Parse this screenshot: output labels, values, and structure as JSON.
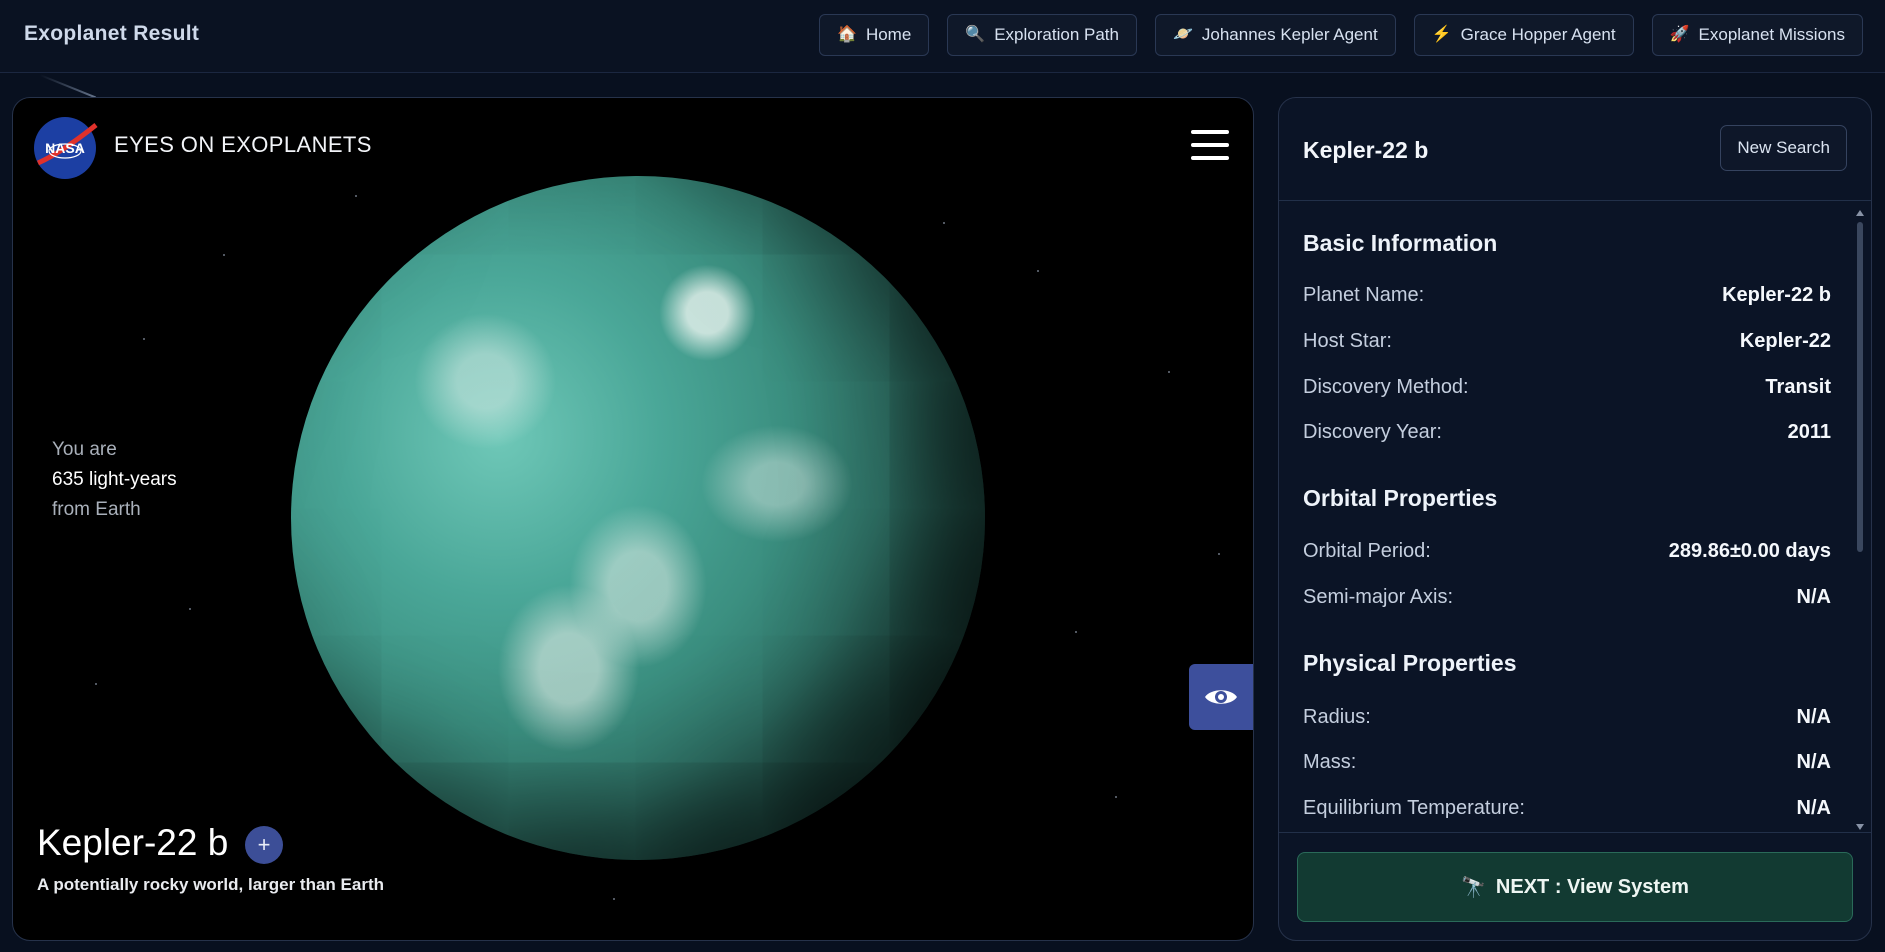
{
  "app": {
    "title": "Exoplanet Result"
  },
  "nav": {
    "items": [
      {
        "label": "Home",
        "icon": "house-icon"
      },
      {
        "label": "Exploration Path",
        "icon": "magnifier-icon"
      },
      {
        "label": "Johannes Kepler Agent",
        "icon": "planet-icon"
      },
      {
        "label": "Grace Hopper Agent",
        "icon": "lightning-icon"
      },
      {
        "label": "Exoplanet Missions",
        "icon": "rocket-icon"
      }
    ]
  },
  "viewer": {
    "brand": "EYES ON EXOPLANETS",
    "distance": {
      "prefix": "You are",
      "value": "635 light-years",
      "suffix": "from Earth"
    },
    "planet_name": "Kepler-22 b",
    "planet_description": "A potentially rocky world, larger than Earth",
    "plus_label": "+"
  },
  "info": {
    "title": "Kepler-22 b",
    "new_search_label": "New Search",
    "sections": {
      "basic": {
        "heading": "Basic Information",
        "rows": [
          {
            "label": "Planet Name:",
            "value": "Kepler-22 b"
          },
          {
            "label": "Host Star:",
            "value": "Kepler-22"
          },
          {
            "label": "Discovery Method:",
            "value": "Transit"
          },
          {
            "label": "Discovery Year:",
            "value": "2011"
          }
        ]
      },
      "orbital": {
        "heading": "Orbital Properties",
        "rows": [
          {
            "label": "Orbital Period:",
            "value": "289.86±0.00 days"
          },
          {
            "label": "Semi-major Axis:",
            "value": "N/A"
          }
        ]
      },
      "physical": {
        "heading": "Physical Properties",
        "rows": [
          {
            "label": "Radius:",
            "value": "N/A"
          },
          {
            "label": "Mass:",
            "value": "N/A"
          },
          {
            "label": "Equilibrium Temperature:",
            "value": "N/A"
          }
        ]
      }
    },
    "next_label": "NEXT : View System"
  },
  "colors": {
    "background": "#08101f",
    "accent_blue": "#3d4f9c",
    "next_button": "#123a32"
  }
}
